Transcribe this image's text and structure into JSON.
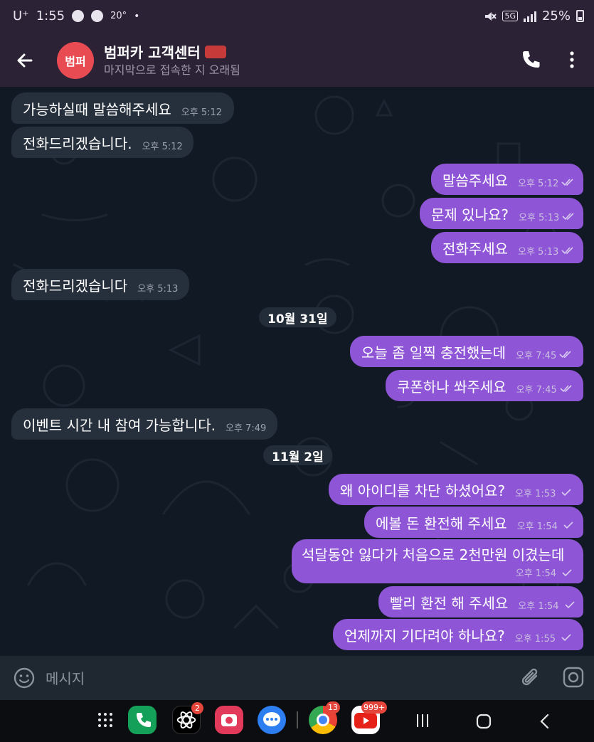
{
  "status_bar": {
    "carrier": "U⁺",
    "time": "1:55",
    "weather": "20°",
    "network": "5G",
    "battery": "25%"
  },
  "header": {
    "avatar_text": "범퍼",
    "title": "범퍼카 고객센터",
    "subtitle": "마지막으로 접속한 지 오래됨"
  },
  "messages": [
    {
      "direction": "in",
      "text": "가능하실때 말씀해주세요",
      "time": "오후 5:12"
    },
    {
      "direction": "in",
      "text": "전화드리겠습니다.",
      "time": "오후 5:12"
    },
    {
      "direction": "out",
      "text": "말씀주세요",
      "time": "오후 5:12",
      "status": "read"
    },
    {
      "direction": "out",
      "text": "문제 있나요?",
      "time": "오후 5:13",
      "status": "read"
    },
    {
      "direction": "out",
      "text": "전화주세요",
      "time": "오후 5:13",
      "status": "read"
    },
    {
      "direction": "in",
      "text": "전화드리겠습니다",
      "time": "오후 5:13"
    },
    {
      "type": "date",
      "text": "10월 31일"
    },
    {
      "direction": "out",
      "text": "오늘 좀 일찍 충전했는데",
      "time": "오후 7:45",
      "status": "read"
    },
    {
      "direction": "out",
      "text": "쿠폰하나 쏴주세요",
      "time": "오후 7:45",
      "status": "read"
    },
    {
      "direction": "in",
      "text": "이벤트 시간 내 참여 가능합니다.",
      "time": "오후 7:49"
    },
    {
      "type": "date",
      "text": "11월 2일"
    },
    {
      "direction": "out",
      "text": "왜 아이디를 차단 하셨어요?",
      "time": "오후 1:53",
      "status": "sent"
    },
    {
      "direction": "out",
      "text": "에볼 돈 환전해 주세요",
      "time": "오후 1:54",
      "status": "sent"
    },
    {
      "direction": "out",
      "text": "석달동안 잃다가 처음으로 2천만원 이겼는데",
      "time": "오후 1:54",
      "status": "sent"
    },
    {
      "direction": "out",
      "text": "빨리 환전 해 주세요",
      "time": "오후 1:54",
      "status": "sent"
    },
    {
      "direction": "out",
      "text": "언제까지 기다려야 하나요?",
      "time": "오후 1:55",
      "status": "sent"
    }
  ],
  "input": {
    "placeholder": "메시지"
  },
  "dock": {
    "badges": {
      "app2": "2",
      "chrome": "13",
      "youtube": "999+"
    }
  },
  "colors": {
    "header_bg": "#2b2236",
    "chat_bg": "#111a24",
    "incoming_bubble": "#26303c",
    "outgoing_bubble": "#8e55d6",
    "avatar": "#e84b52"
  }
}
